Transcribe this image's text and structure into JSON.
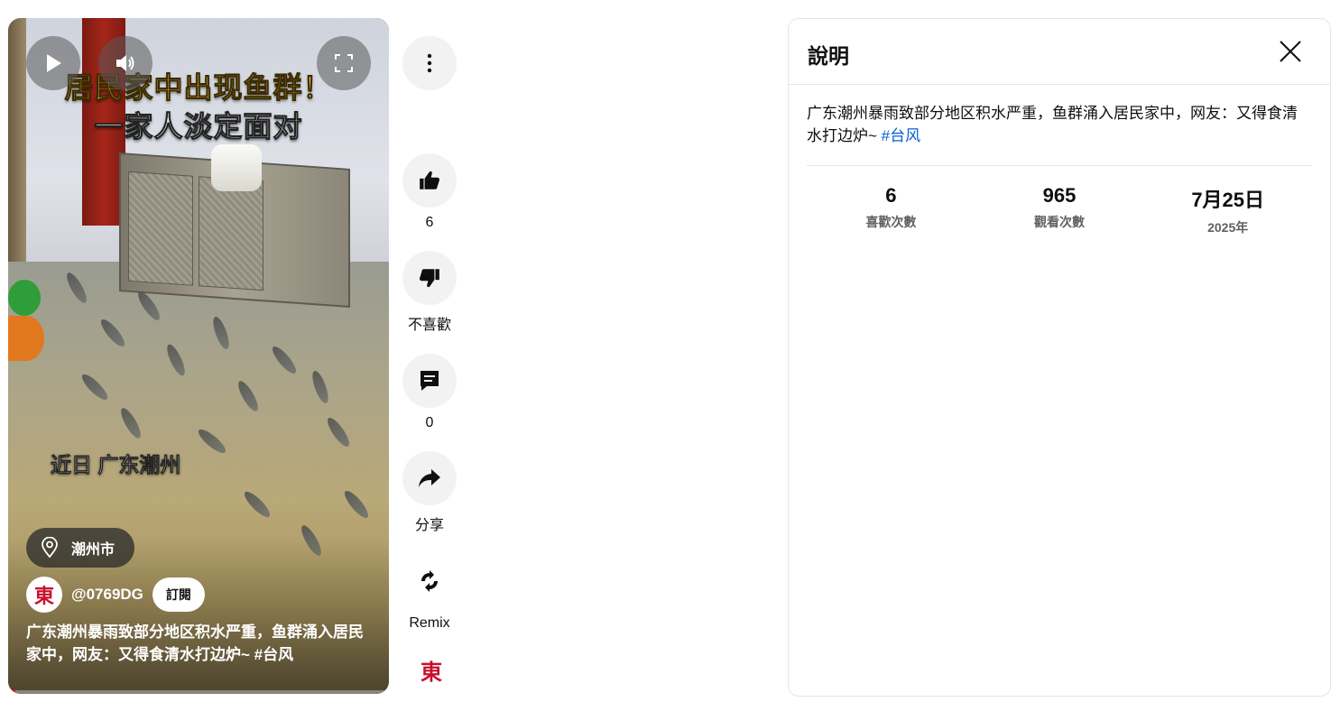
{
  "video": {
    "caption_line1": "居民家中出现鱼群！",
    "caption_line2": "一家人淡定面对",
    "caption_line3": "近日 广东潮州",
    "location": "潮州市",
    "channel_handle": "@0769DG",
    "subscribe_label": "訂閱",
    "title": "广东潮州暴雨致部分地区积水严重，鱼群涌入居民家中，网友：又得食清水打边炉~",
    "hashtag": "#台风",
    "progress_fraction": 0.02,
    "avatar_glyph": "東"
  },
  "rail": {
    "like_count": "6",
    "dislike_label": "不喜歡",
    "comment_count": "0",
    "share_label": "分享",
    "remix_label": "Remix"
  },
  "panel": {
    "title": "說明",
    "description": "广东潮州暴雨致部分地区积水严重，鱼群涌入居民家中，网友：又得食清水打边炉~",
    "hashtag": "#台风",
    "stats": [
      {
        "value": "6",
        "label": "喜歡次數"
      },
      {
        "value": "965",
        "label": "觀看次數"
      },
      {
        "value": "7月25日",
        "label": "2025年"
      }
    ]
  },
  "colors": {
    "accent_link": "#065fd4",
    "progress_red": "#ff0033",
    "brand_red": "#c8102e"
  }
}
